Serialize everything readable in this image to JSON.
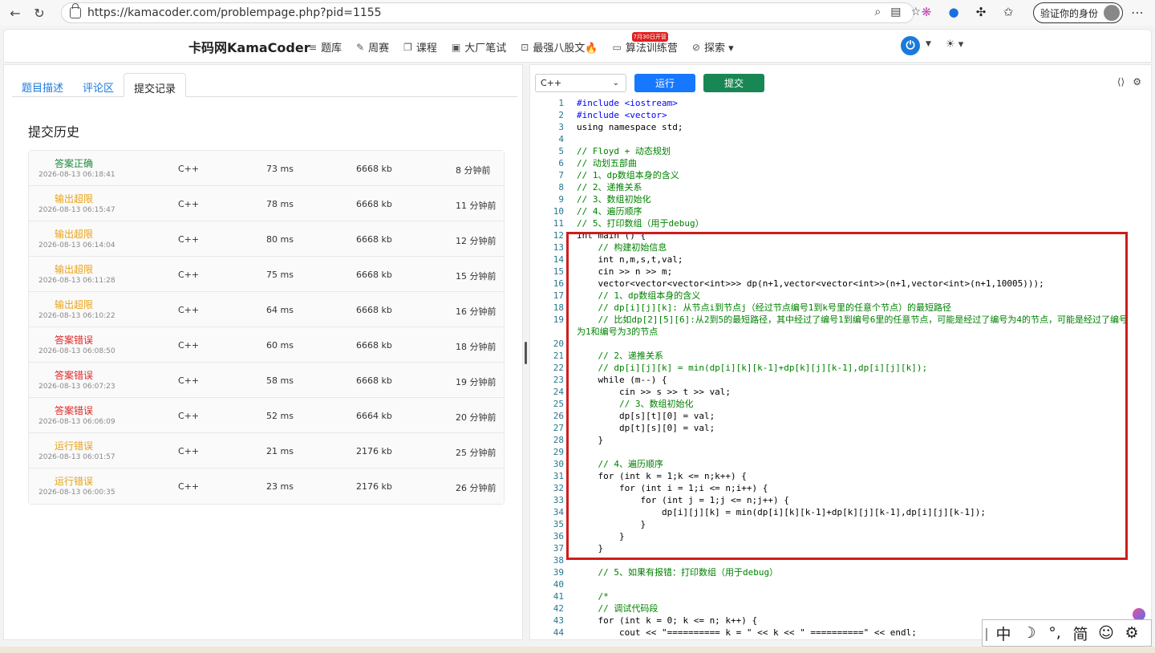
{
  "browser": {
    "url": "https://kamacoder.com/problempage.php?pid=1155",
    "verify_label": "验证你的身份"
  },
  "site": {
    "brand": "卡码网KamaCoder",
    "nav": [
      {
        "icon": "list-icon",
        "label": "题库"
      },
      {
        "icon": "pencil-icon",
        "label": "周赛"
      },
      {
        "icon": "book-icon",
        "label": "课程"
      },
      {
        "icon": "doc-icon",
        "label": "大厂笔试"
      },
      {
        "icon": "code-icon",
        "label": "最强八股文🔥"
      },
      {
        "icon": "camp-icon",
        "label": "算法训练营"
      },
      {
        "icon": "compass-icon",
        "label": "探索 ▾"
      }
    ],
    "camp_badge": "7月30日开营"
  },
  "left": {
    "tabs": [
      "题目描述",
      "评论区",
      "提交记录"
    ],
    "active_tab": 2,
    "history_title": "提交历史",
    "submissions": [
      {
        "status": "答案正确",
        "kind": "ok",
        "time": "2026-08-13 06:18:41",
        "lang": "C++",
        "ms": "73 ms",
        "mem": "6668 kb",
        "ago": "8 分钟前"
      },
      {
        "status": "输出超限",
        "kind": "warn",
        "time": "2026-08-13 06:15:47",
        "lang": "C++",
        "ms": "78 ms",
        "mem": "6668 kb",
        "ago": "11 分钟前"
      },
      {
        "status": "输出超限",
        "kind": "warn",
        "time": "2026-08-13 06:14:04",
        "lang": "C++",
        "ms": "80 ms",
        "mem": "6668 kb",
        "ago": "12 分钟前"
      },
      {
        "status": "输出超限",
        "kind": "warn",
        "time": "2026-08-13 06:11:28",
        "lang": "C++",
        "ms": "75 ms",
        "mem": "6668 kb",
        "ago": "15 分钟前"
      },
      {
        "status": "输出超限",
        "kind": "warn",
        "time": "2026-08-13 06:10:22",
        "lang": "C++",
        "ms": "64 ms",
        "mem": "6668 kb",
        "ago": "16 分钟前"
      },
      {
        "status": "答案错误",
        "kind": "err",
        "time": "2026-08-13 06:08:50",
        "lang": "C++",
        "ms": "60 ms",
        "mem": "6668 kb",
        "ago": "18 分钟前"
      },
      {
        "status": "答案错误",
        "kind": "err",
        "time": "2026-08-13 06:07:23",
        "lang": "C++",
        "ms": "58 ms",
        "mem": "6668 kb",
        "ago": "19 分钟前"
      },
      {
        "status": "答案错误",
        "kind": "err",
        "time": "2026-08-13 06:06:09",
        "lang": "C++",
        "ms": "52 ms",
        "mem": "6664 kb",
        "ago": "20 分钟前"
      },
      {
        "status": "运行错误",
        "kind": "warn",
        "time": "2026-08-13 06:01:57",
        "lang": "C++",
        "ms": "21 ms",
        "mem": "2176 kb",
        "ago": "25 分钟前"
      },
      {
        "status": "运行错误",
        "kind": "warn",
        "time": "2026-08-13 06:00:35",
        "lang": "C++",
        "ms": "23 ms",
        "mem": "2176 kb",
        "ago": "26 分钟前"
      }
    ]
  },
  "editor": {
    "language": "C++",
    "run_label": "运行",
    "submit_label": "提交",
    "lines": [
      "#include <iostream>",
      "#include <vector>",
      "using namespace std;",
      "",
      "// Floyd + 动态规划",
      "// 动划五部曲",
      "// 1、dp数组本身的含义",
      "// 2、递推关系",
      "// 3、数组初始化",
      "// 4、遍历顺序",
      "// 5、打印数组（用于debug）",
      "int main () {",
      "    // 构建初始信息",
      "    int n,m,s,t,val;",
      "    cin >> n >> m;",
      "    vector<vector<vector<int>>> dp(n+1,vector<vector<int>>(n+1,vector<int>(n+1,10005)));",
      "    // 1、dp数组本身的含义",
      "    // dp[i][j][k]: 从节点i到节点j（经过节点编号1到k号里的任意个节点）的最短路径",
      "    // 比如dp[2][5][6]:从2到5的最短路径，其中经过了编号1到编号6里的任意节点，可能是经过了编号为4的节点，可能是经过了编号为1和编号为3的节点",
      "",
      "    // 2、递推关系",
      "    // dp[i][j][k] = min(dp[i][k][k-1]+dp[k][j][k-1],dp[i][j][k]);",
      "    while (m--) {",
      "        cin >> s >> t >> val;",
      "        // 3、数组初始化",
      "        dp[s][t][0] = val;",
      "        dp[t][s][0] = val;",
      "    }",
      "",
      "    // 4、遍历顺序",
      "    for (int k = 1;k <= n;k++) {",
      "        for (int i = 1;i <= n;i++) {",
      "            for (int j = 1;j <= n;j++) {",
      "                dp[i][j][k] = min(dp[i][k][k-1]+dp[k][j][k-1],dp[i][j][k-1]);",
      "            }",
      "        }",
      "    }",
      "",
      "    // 5、如果有报错：打印数组（用于debug）",
      "",
      "    /*",
      "    // 调试代码段",
      "    for (int k = 0; k <= n; k++) {",
      "        cout << \"========== k = \" << k << \" ==========\" << endl;"
    ]
  },
  "ime": {
    "chars": [
      "中",
      "☽",
      "°,",
      "简",
      "☺",
      "⚙"
    ]
  }
}
